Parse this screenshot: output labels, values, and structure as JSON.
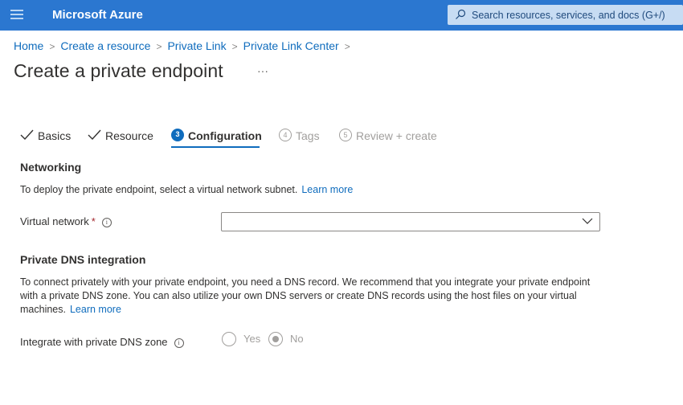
{
  "topbar": {
    "menu_icon": "hamburger-menu-icon",
    "brand": "Microsoft Azure",
    "search_placeholder": "Search resources, services, and docs (G+/)",
    "search_icon": "search-icon"
  },
  "breadcrumb": {
    "items": [
      "Home",
      "Create a resource",
      "Private Link",
      "Private Link Center"
    ],
    "separator": ">"
  },
  "page": {
    "title": "Create a private endpoint",
    "more": "···"
  },
  "tabs": [
    {
      "label": "Basics",
      "state": "completed",
      "marker": "✓"
    },
    {
      "label": "Resource",
      "state": "completed",
      "marker": "✓"
    },
    {
      "label": "Configuration",
      "state": "active",
      "marker": "3"
    },
    {
      "label": "Tags",
      "state": "pending",
      "marker": "4"
    },
    {
      "label": "Review + create",
      "state": "pending",
      "marker": "5"
    }
  ],
  "networking": {
    "title": "Networking",
    "description": "To deploy the private endpoint, select a virtual network subnet.",
    "learn_more": "Learn more",
    "virtual_network": {
      "label": "Virtual network",
      "required": "*",
      "info_icon": "i",
      "value": ""
    }
  },
  "dns": {
    "title": "Private DNS integration",
    "description": "To connect privately with your private endpoint, you need a DNS record. We recommend that you integrate your private endpoint with a private DNS zone. You can also utilize your own DNS servers or create DNS records using the host files on your virtual machines.",
    "learn_more": "Learn more",
    "integrate": {
      "label": "Integrate with private DNS zone",
      "info_icon": "i",
      "options": [
        "Yes",
        "No"
      ],
      "selected": "No",
      "disabled": true
    }
  },
  "colors": {
    "topbar": "#2b77d0",
    "accent": "#0f6cbd",
    "required": "#a4262c",
    "disabled": "#a19f9d"
  }
}
